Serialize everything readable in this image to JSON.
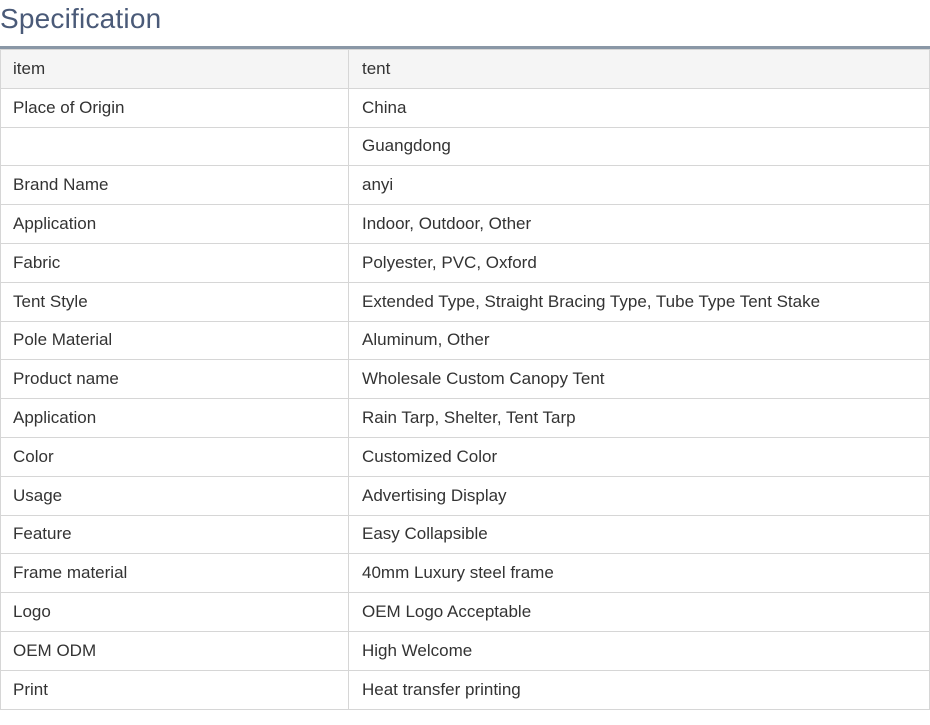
{
  "title": "Specification",
  "table": {
    "header": {
      "key": "item",
      "value": "tent"
    },
    "rows": [
      {
        "key": "Place of Origin",
        "value": "China"
      },
      {
        "key": "",
        "value": "Guangdong"
      },
      {
        "key": "Brand Name",
        "value": "anyi"
      },
      {
        "key": "Application",
        "value": "Indoor, Outdoor, Other"
      },
      {
        "key": "Fabric",
        "value": "Polyester, PVC, Oxford"
      },
      {
        "key": "Tent Style",
        "value": "Extended Type, Straight Bracing Type, Tube Type Tent Stake"
      },
      {
        "key": "Pole Material",
        "value": "Aluminum, Other"
      },
      {
        "key": "Product name",
        "value": "Wholesale Custom Canopy Tent"
      },
      {
        "key": "Application",
        "value": "Rain Tarp, Shelter, Tent Tarp"
      },
      {
        "key": "Color",
        "value": "Customized Color"
      },
      {
        "key": "Usage",
        "value": "Advertising Display"
      },
      {
        "key": "Feature",
        "value": "Easy Collapsible"
      },
      {
        "key": "Frame material",
        "value": "40mm Luxury steel frame"
      },
      {
        "key": "Logo",
        "value": "OEM Logo Acceptable"
      },
      {
        "key": "OEM ODM",
        "value": "High Welcome"
      },
      {
        "key": "Print",
        "value": "Heat transfer printing"
      }
    ]
  },
  "colors": {
    "title": "#4a5a78",
    "header_rule": "#8a97a6",
    "header_row_bg": "#f5f5f5",
    "border": "#d6d6d6",
    "text": "#333333"
  }
}
